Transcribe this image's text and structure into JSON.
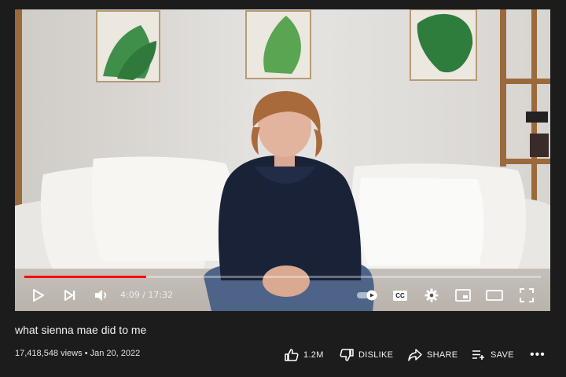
{
  "video": {
    "title": "what sienna mae did to me",
    "views": "17,418,548 views",
    "separator": "•",
    "date": "Jan 20, 2022",
    "progress_fraction": 0.236
  },
  "player": {
    "current_time": "4:09",
    "time_separator": "/",
    "duration": "17:32",
    "autoplay_on": true,
    "icons": {
      "play": "play-icon",
      "next": "skip-next-icon",
      "volume": "volume-icon",
      "autoplay": "autoplay-toggle-icon",
      "captions": "captions-icon",
      "settings": "gear-icon",
      "miniplayer": "miniplayer-icon",
      "theater": "theater-mode-icon",
      "fullscreen": "fullscreen-icon"
    },
    "captions_label": "CC",
    "accent_color": "#ff0000"
  },
  "actions": {
    "like_count": "1.2M",
    "dislike_label": "DISLIKE",
    "share_label": "SHARE",
    "save_label": "SAVE",
    "more_label": "•••"
  }
}
